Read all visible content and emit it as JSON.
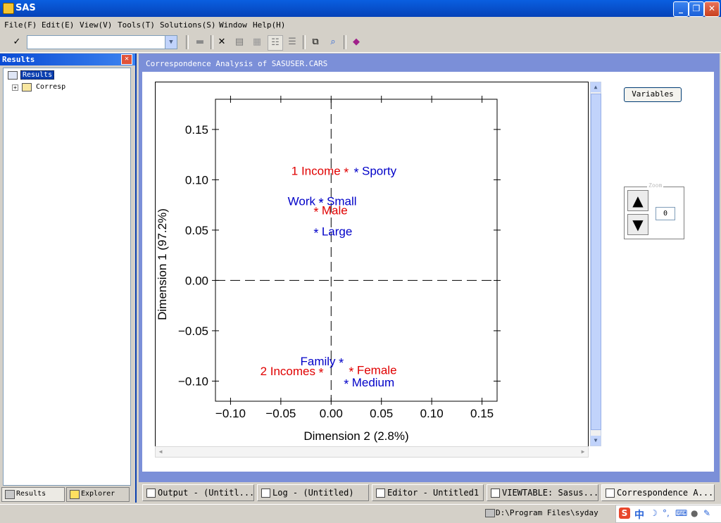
{
  "window": {
    "title": "SAS"
  },
  "menu": [
    {
      "label": "File(F)"
    },
    {
      "label": "Edit(E)"
    },
    {
      "label": "View(V)"
    },
    {
      "label": "Tools(T)"
    },
    {
      "label": "Solutions(S)"
    },
    {
      "label": "Window"
    },
    {
      "label": "Help(H)"
    }
  ],
  "toolbar": {
    "command_value": ""
  },
  "results_panel": {
    "title": "Results",
    "tree": [
      {
        "label": "Results",
        "selected": true
      },
      {
        "label": "Corresp",
        "selected": false
      }
    ],
    "tabs": [
      {
        "label": "Results",
        "icon": "results-icon"
      },
      {
        "label": "Explorer",
        "icon": "explorer-icon"
      }
    ]
  },
  "graph_window": {
    "title": "Correspondence Analysis of SASUSER.CARS",
    "variables_button": "Variables",
    "zoom": {
      "legend": "Zoom",
      "value": "0"
    }
  },
  "colors": {
    "row_points": "#e00000",
    "column_points": "#0000c8"
  },
  "chart_data": {
    "type": "scatter",
    "title": "",
    "xlabel": "Dimension 2  (2.8%)",
    "ylabel": "Dimension 1  (97.2%)",
    "xlim": [
      -0.115,
      0.165
    ],
    "ylim": [
      -0.12,
      0.18
    ],
    "x_ticks": [
      -0.1,
      -0.05,
      0.0,
      0.05,
      0.1,
      0.15
    ],
    "x_tick_labels": [
      "−0.10",
      "−0.05",
      "0.00",
      "0.05",
      "0.10",
      "0.15"
    ],
    "y_ticks": [
      0.15,
      0.1,
      0.05,
      0.0,
      -0.05,
      -0.1
    ],
    "y_tick_labels": [
      "0.15",
      "0.10",
      "0.05",
      "0.00",
      "−0.05",
      "−0.10"
    ],
    "reference_lines": {
      "x": 0,
      "y": 0,
      "style": "dashed"
    },
    "series": [
      {
        "name": "",
        "color": "#e00000",
        "points": [
          {
            "label": "1 Income",
            "x": 0.015,
            "y": 0.109,
            "label_side": "left"
          },
          {
            "label": "Male",
            "x": -0.015,
            "y": 0.07,
            "label_side": "right"
          },
          {
            "label": "2 Incomes",
            "x": -0.01,
            "y": -0.09,
            "label_side": "left"
          },
          {
            "label": "Female",
            "x": 0.02,
            "y": -0.089,
            "label_side": "right"
          }
        ]
      },
      {
        "name": "",
        "color": "#0000c8",
        "points": [
          {
            "label": "Sporty",
            "x": 0.025,
            "y": 0.109,
            "label_side": "right"
          },
          {
            "label": "Work",
            "x": -0.01,
            "y": 0.079,
            "label_side": "left"
          },
          {
            "label": "Small",
            "x": -0.01,
            "y": 0.079,
            "label_side": "right"
          },
          {
            "label": "Large",
            "x": -0.015,
            "y": 0.049,
            "label_side": "right"
          },
          {
            "label": "Family",
            "x": 0.01,
            "y": -0.08,
            "label_side": "left"
          },
          {
            "label": "Medium",
            "x": 0.015,
            "y": -0.101,
            "label_side": "right"
          }
        ]
      }
    ]
  },
  "taskbar": [
    {
      "label": "Output - (Untitl..."
    },
    {
      "label": "Log - (Untitled)"
    },
    {
      "label": "Editor - Untitled1"
    },
    {
      "label": "VIEWTABLE: Sasus..."
    },
    {
      "label": "Correspondence A..."
    }
  ],
  "status": {
    "path": "D:\\Program Files\\syday"
  }
}
